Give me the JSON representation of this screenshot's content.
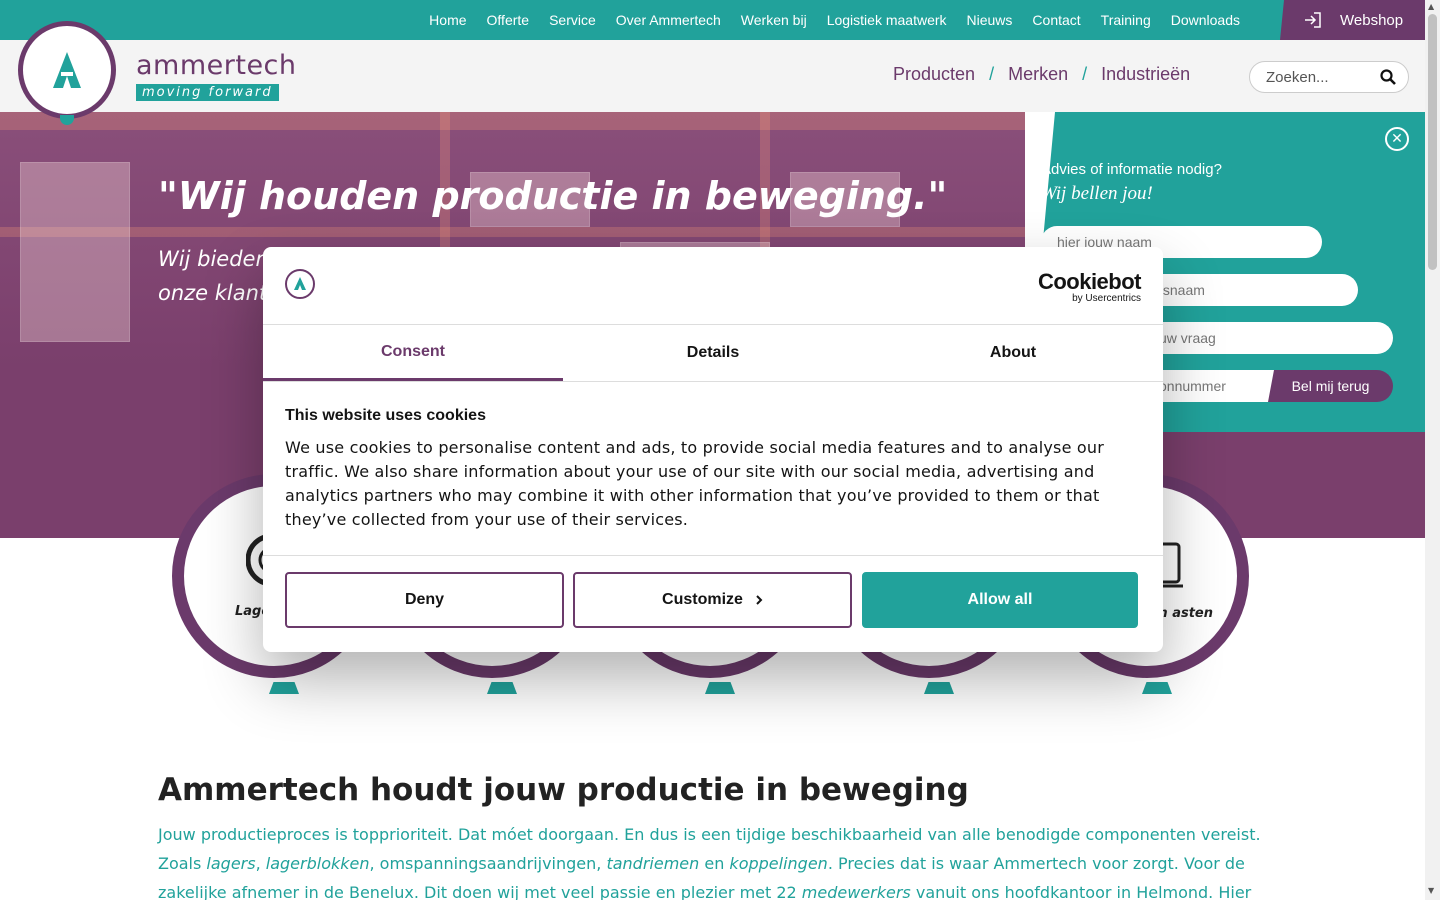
{
  "topnav": [
    "Home",
    "Offerte",
    "Service",
    "Over Ammertech",
    "Werken bij",
    "Logistiek maatwerk",
    "Nieuws",
    "Contact",
    "Training",
    "Downloads"
  ],
  "webshop": {
    "label": "Webshop",
    "icon": "login-icon"
  },
  "logo": {
    "name": "ammertech",
    "tagline": "moving forward"
  },
  "mainnav": {
    "items": [
      "Producten",
      "Merken",
      "Industrieën"
    ],
    "separator": "/"
  },
  "search": {
    "placeholder": "Zoeken..."
  },
  "hero": {
    "quote": "\"Wij houden productie in beweging.\"",
    "text": "Wij bieden onze klant"
  },
  "sideform": {
    "question": "Advies of informatie nodig?",
    "subtitle": "Wij bellen jou!",
    "name_placeholder": "hier jouw naam",
    "company_placeholder": "fsnaam",
    "question_placeholder": "uw vraag",
    "phone_placeholder": "onnummer",
    "submit": "Bel mij terug"
  },
  "categories": [
    {
      "label": "Lage"
    },
    {
      "label": ""
    },
    {
      "label": ""
    },
    {
      "label": ""
    },
    {
      "label": "oren en asten"
    }
  ],
  "content": {
    "heading": "Ammertech houdt jouw productie in beweging",
    "p1": "Jouw productieproces is topprioriteit. Dat móet doorgaan. En dus is een tijdige beschikbaarheid van alle benodigde componenten vereist. Zoals ",
    "lagers": "lagers",
    "p2": ", ",
    "lagerblokken": "lagerblokken",
    "p3": ", omspanningsaandrijvingen, ",
    "tandriemen": "tandriemen",
    "p4": " en ",
    "koppelingen": "koppelingen",
    "p5": ". Precies dat is waar Ammertech voor zorgt. Voor de zakelijke afnemer in de Benelux. Dit doen wij met veel passie en plezier met 22 ",
    "medewerkers": "medewerkers",
    "p6": " vanuit ons hoofdkantoor in Helmond. Hier is ook ons centrale distributiecentrum"
  },
  "cookie_dialog": {
    "brand": "Cookiebot",
    "brand_by": "by Usercentrics",
    "tabs": [
      "Consent",
      "Details",
      "About"
    ],
    "active_tab": "Consent",
    "title": "This website uses cookies",
    "text": "We use cookies to personalise content and ads, to provide social media features and to analyse our traffic. We also share information about your use of our site with our social media, advertising and analytics partners who may combine it with other information that you’ve provided to them or that they’ve collected from your use of their services.",
    "deny": "Deny",
    "customize": "Customize",
    "allow": "Allow all"
  },
  "colors": {
    "teal": "#21a29b",
    "purple": "#6b3a6b"
  }
}
